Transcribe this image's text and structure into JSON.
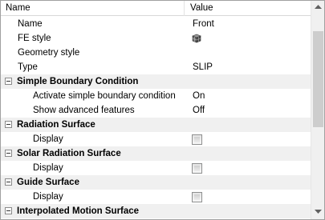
{
  "header": {
    "name": "Name",
    "value": "Value"
  },
  "rows": [
    {
      "label": "Name",
      "value": "Front"
    },
    {
      "label": "FE style",
      "value_icon": "fe-style-icon"
    },
    {
      "label": "Geometry style",
      "value": ""
    },
    {
      "label": "Type",
      "value": "SLIP"
    },
    {
      "category": "Simple Boundary Condition"
    },
    {
      "label": "Activate simple boundary condition",
      "value": "On"
    },
    {
      "label": "Show advanced features",
      "value": "Off"
    },
    {
      "category": "Radiation Surface"
    },
    {
      "label": "Display",
      "checked": false
    },
    {
      "category": "Solar Radiation Surface"
    },
    {
      "label": "Display",
      "checked": false
    },
    {
      "category": "Guide Surface"
    },
    {
      "label": "Display",
      "checked": false
    },
    {
      "category": "Interpolated Motion Surface"
    }
  ],
  "colors": {
    "category_bg": "#f0f0f0",
    "scrollbar_bg": "#f0f0f0",
    "scroll_thumb": "#cdcdcd"
  }
}
